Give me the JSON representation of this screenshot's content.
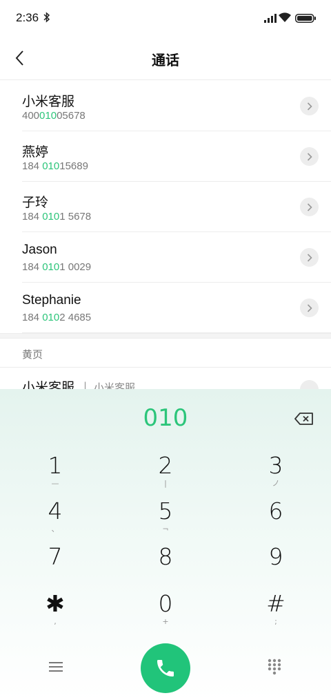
{
  "status": {
    "time": "2:36"
  },
  "header": {
    "title": "通话"
  },
  "contacts": [
    {
      "name": "小米客服",
      "number_pre": "400",
      "number_hl": "010",
      "number_post": "05678"
    },
    {
      "name": "燕婷",
      "number_pre": "184 ",
      "number_hl": "010",
      "number_post": "15689"
    },
    {
      "name": "子玲",
      "number_pre": "184 ",
      "number_hl": "010",
      "number_post": "1 5678"
    },
    {
      "name": "Jason",
      "number_pre": "184 ",
      "number_hl": "010",
      "number_post": "1 0029"
    },
    {
      "name": "Stephanie",
      "number_pre": "184 ",
      "number_hl": "010",
      "number_post": "2 4685"
    }
  ],
  "yellow_pages": {
    "section_label": "黄页",
    "item": {
      "name": "小米客服",
      "separator": "|",
      "sub": "小米客服"
    }
  },
  "dialpad": {
    "display": "010",
    "keys": [
      {
        "digit": "1",
        "sub": "—"
      },
      {
        "digit": "2",
        "sub": "|"
      },
      {
        "digit": "3",
        "sub": "ノ"
      },
      {
        "digit": "4",
        "sub": "、"
      },
      {
        "digit": "5",
        "sub": "¬"
      },
      {
        "digit": "6",
        "sub": ""
      },
      {
        "digit": "7",
        "sub": ""
      },
      {
        "digit": "8",
        "sub": ""
      },
      {
        "digit": "9",
        "sub": ""
      },
      {
        "digit": "✱",
        "sub": ","
      },
      {
        "digit": "0",
        "sub": "+"
      },
      {
        "digit": "#",
        "sub": ";"
      }
    ]
  },
  "colors": {
    "accent": "#2cc57a",
    "call": "#21c47a"
  }
}
